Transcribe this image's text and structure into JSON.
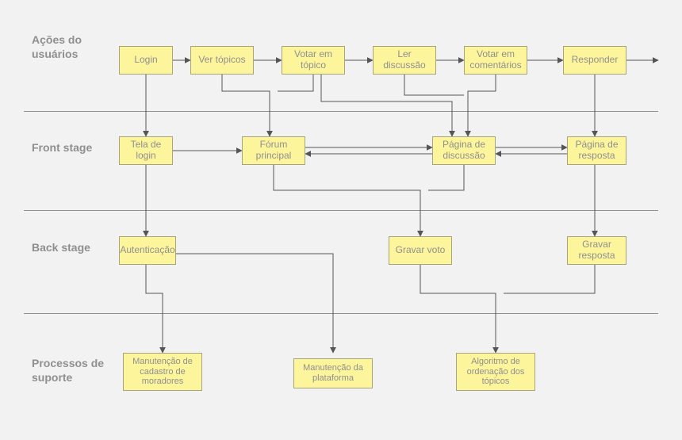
{
  "lanes": {
    "user_actions": "Ações do usuários",
    "front_stage": "Front stage",
    "back_stage": "Back stage",
    "support": "Processos de suporte"
  },
  "nodes": {
    "login": "Login",
    "ver_topicos": "Ver tópicos",
    "votar_topico": "Votar em tópico",
    "ler_discussao": "Ler discussão",
    "votar_comentarios": "Votar em comentários",
    "responder": "Responder",
    "tela_login": "Tela de login",
    "forum_principal": "Fórum principal",
    "pagina_discussao": "Página de discussão",
    "pagina_resposta": "Página de resposta",
    "autenticacao": "Autenticação",
    "gravar_voto": "Gravar voto",
    "gravar_resposta": "Gravar resposta",
    "manut_cadastro": "Manutenção de cadastro de moradores",
    "manut_plataforma": "Manutenção da plataforma",
    "algoritmo_ordenacao": "Algoritmo de ordenação dos tópicos"
  }
}
